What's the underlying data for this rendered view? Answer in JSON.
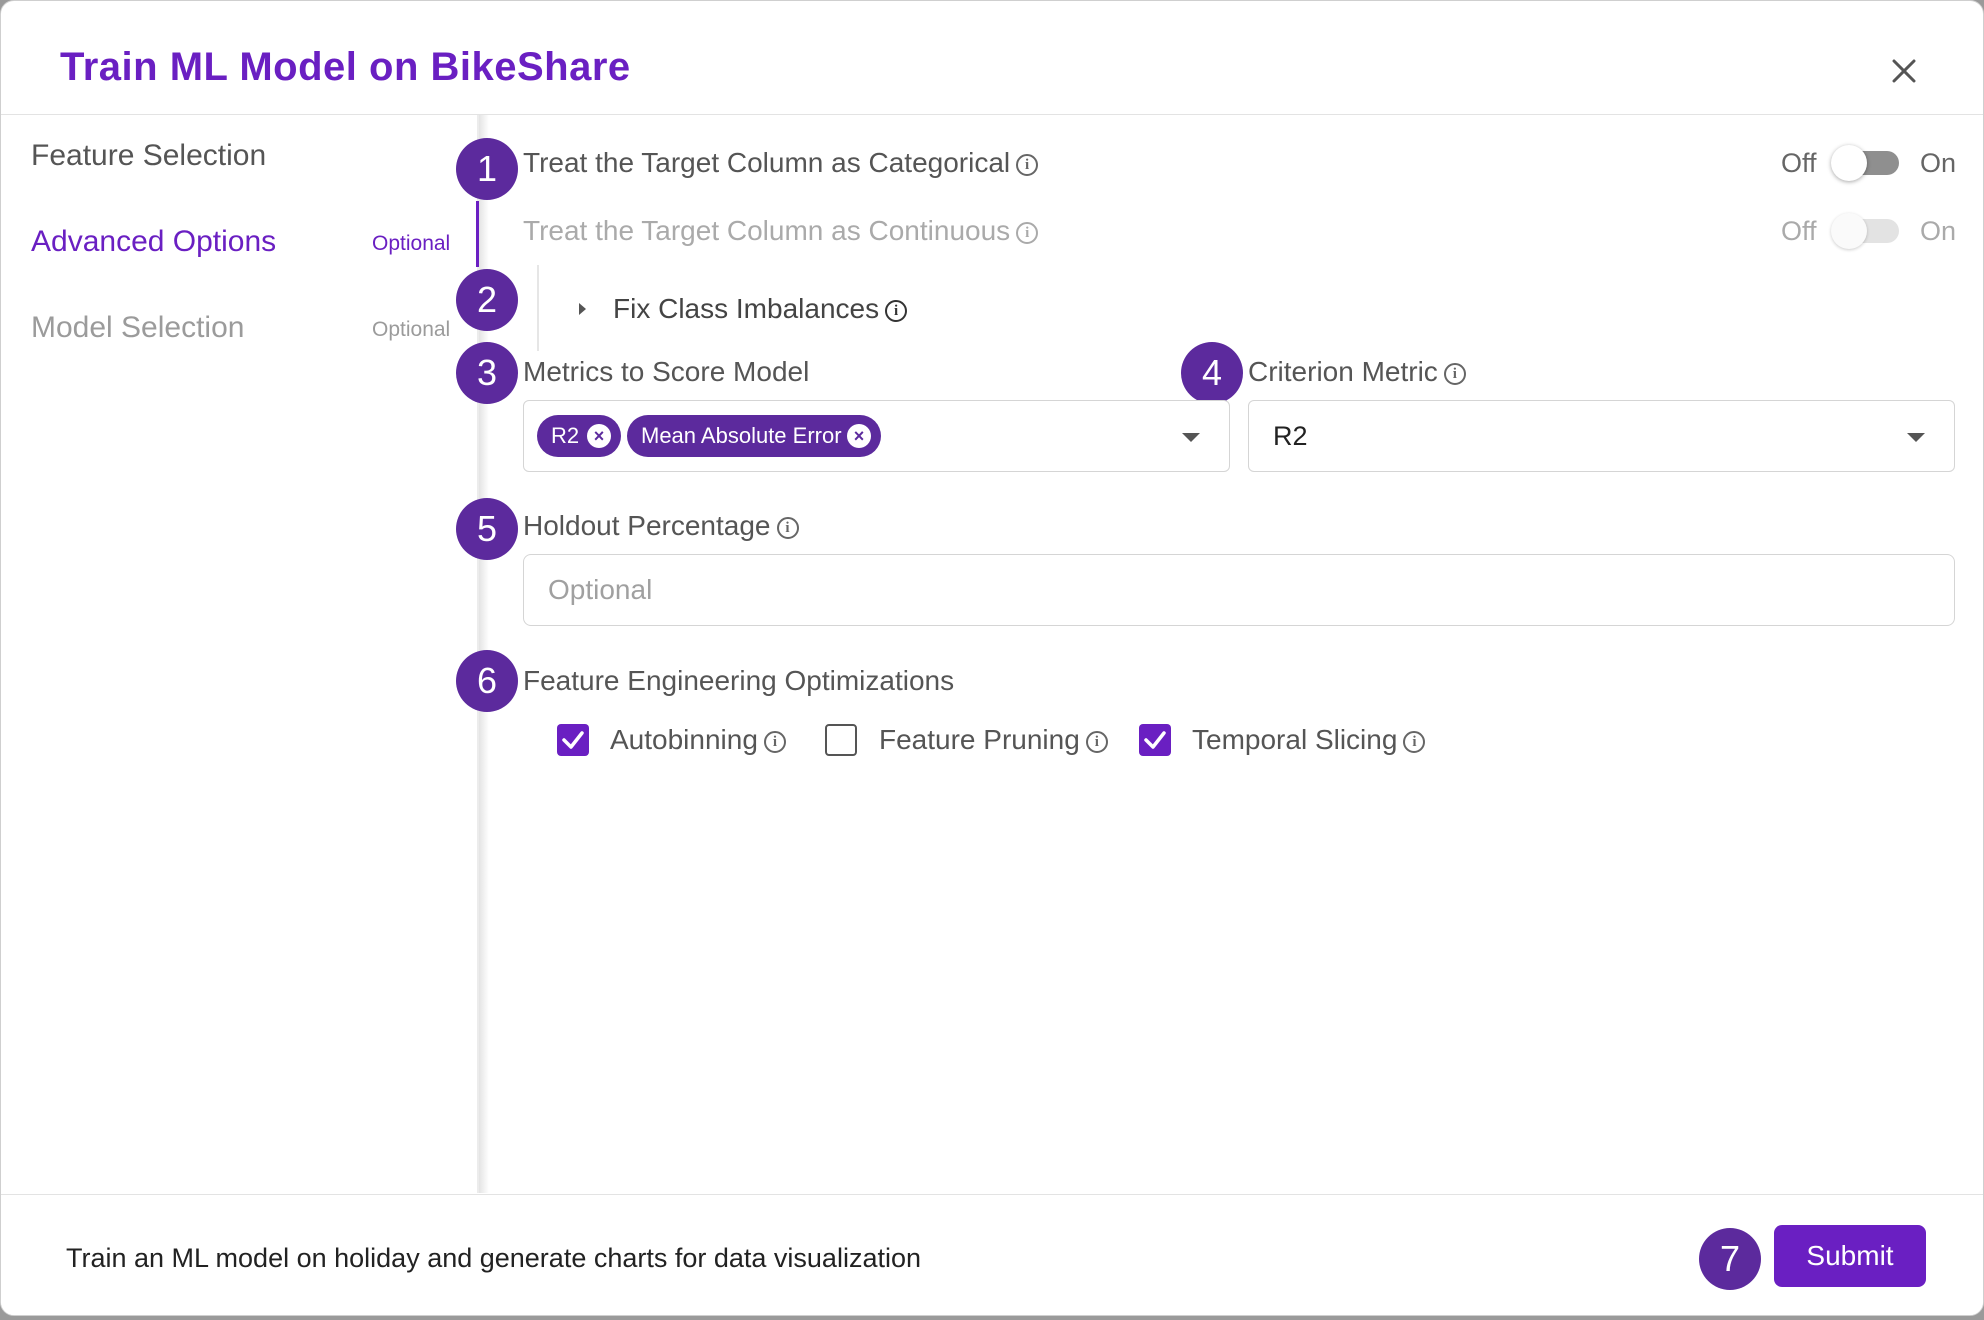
{
  "header": {
    "title": "Train ML Model on BikeShare",
    "close_icon": "close-icon"
  },
  "sidebar": {
    "items": [
      {
        "label": "Feature Selection",
        "optional": "",
        "state": "default"
      },
      {
        "label": "Advanced Options",
        "optional": "Optional",
        "state": "active"
      },
      {
        "label": "Model Selection",
        "optional": "Optional",
        "state": "disabled"
      }
    ]
  },
  "steps": {
    "s1": "1",
    "s2": "2",
    "s3": "3",
    "s4": "4",
    "s5": "5",
    "s6": "6",
    "s7": "7"
  },
  "options": {
    "categorical": {
      "label": "Treat the Target Column as Categorical",
      "off": "Off",
      "on": "On",
      "value": false
    },
    "continuous": {
      "label": "Treat the Target Column as Continuous",
      "off": "Off",
      "on": "On",
      "value": false,
      "disabled": true
    },
    "fix_class": {
      "label": "Fix Class Imbalances"
    },
    "metrics": {
      "label": "Metrics to Score Model",
      "chips": [
        "R2",
        "Mean Absolute Error"
      ]
    },
    "criterion": {
      "label": "Criterion Metric",
      "value": "R2"
    },
    "holdout": {
      "label": "Holdout Percentage",
      "placeholder": "Optional",
      "value": ""
    },
    "feature_eng": {
      "label": "Feature Engineering Optimizations",
      "checkboxes": [
        {
          "label": "Autobinning",
          "checked": true
        },
        {
          "label": "Feature Pruning",
          "checked": false
        },
        {
          "label": "Temporal Slicing",
          "checked": true
        }
      ]
    }
  },
  "footer": {
    "description": "Train an ML model on holiday and generate charts for data visualization",
    "submit_label": "Submit"
  },
  "colors": {
    "accent": "#6a1fc2",
    "badge": "#5c2a9d"
  }
}
